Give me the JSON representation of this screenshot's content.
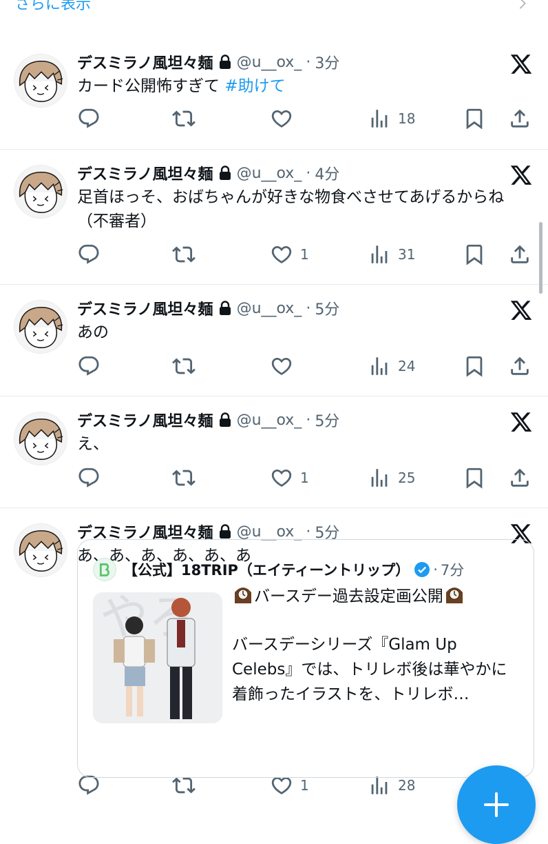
{
  "header": {
    "show_more": "さらに表示"
  },
  "icons": {
    "reply": "reply-icon",
    "retweet": "retweet-icon",
    "like": "heart-icon",
    "views": "views-icon",
    "bookmark": "bookmark-icon",
    "share": "share-icon",
    "lock": "lock-icon",
    "x": "x-logo-icon",
    "verified": "verified-badge-icon"
  },
  "colors": {
    "accent": "#1d9bf0",
    "secondary_text": "#536471"
  },
  "tweets": [
    {
      "name": "デスミラノ風坦々麺",
      "handle": "@u__ox_",
      "time": "3分",
      "text": "カード公開怖すぎて ",
      "hashtag": "#助けて",
      "likes": "",
      "views": "18"
    },
    {
      "name": "デスミラノ風坦々麺",
      "handle": "@u__ox_",
      "time": "4分",
      "text": "足首ほっそ、おばちゃんが好きな物食べさせてあげるからね（不審者）",
      "likes": "1",
      "views": "31"
    },
    {
      "name": "デスミラノ風坦々麺",
      "handle": "@u__ox_",
      "time": "5分",
      "text": "あの",
      "likes": "",
      "views": "24"
    },
    {
      "name": "デスミラノ風坦々麺",
      "handle": "@u__ox_",
      "time": "5分",
      "text": "え、",
      "likes": "1",
      "views": "25"
    },
    {
      "name": "デスミラノ風坦々麺",
      "handle": "@u__ox_",
      "time": "5分",
      "text": "あ、あ、あ、あ、あ、あ",
      "likes": "1",
      "views": "28",
      "quote": {
        "name": "【公式】18TRIP（エイティーントリップ）",
        "time": "7分",
        "title": "バースデー過去設定画公開",
        "body": "バースデーシリーズ『Glam Up Celebs』では、トリレボ後は華やかに着飾ったイラストを、トリレボ…"
      }
    }
  ],
  "fab": {
    "label": "+"
  }
}
